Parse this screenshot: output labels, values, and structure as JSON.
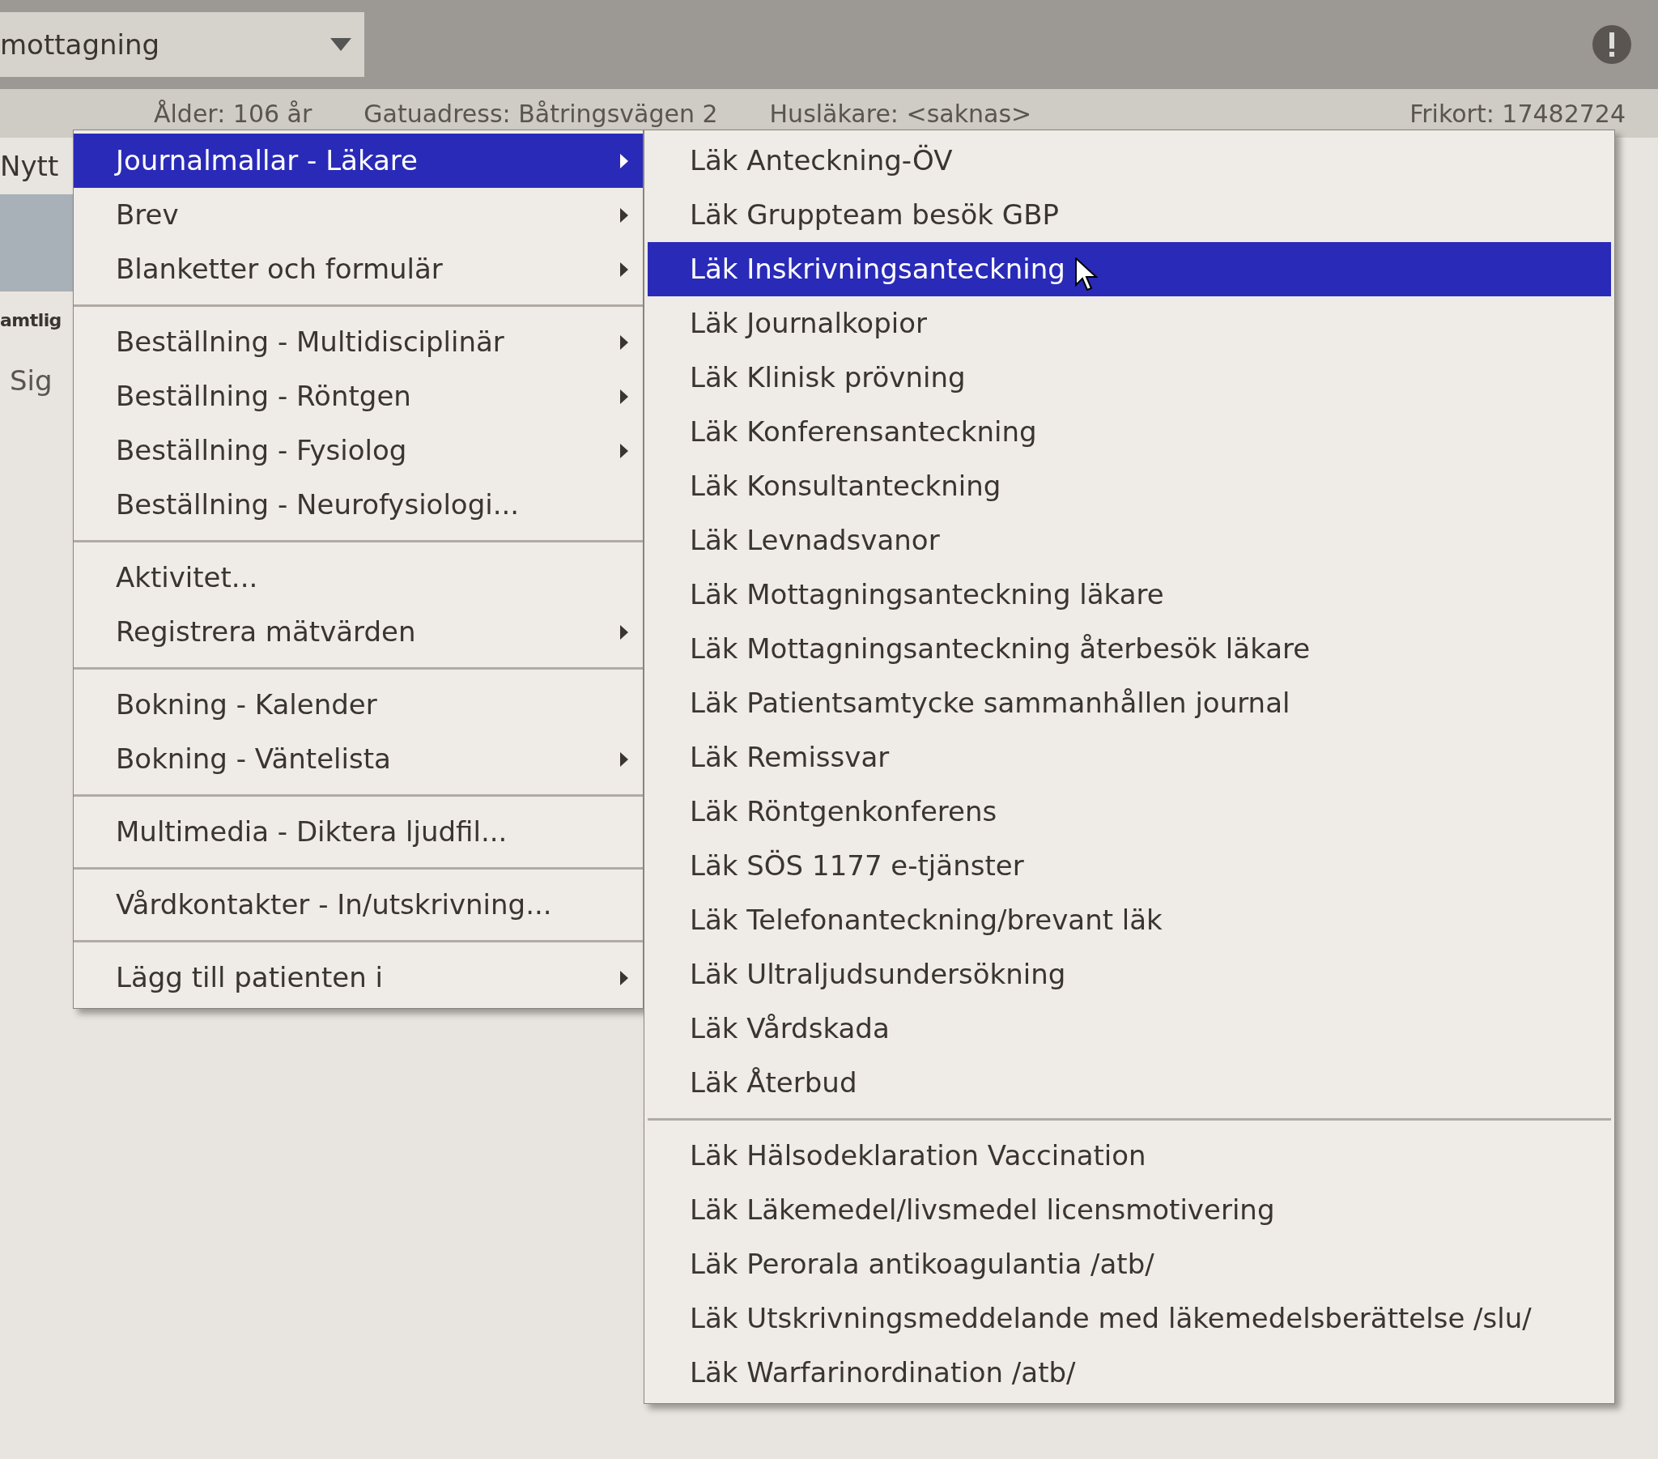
{
  "toolbar": {
    "unit_field": {
      "value": "mottagning"
    }
  },
  "patient_bar": {
    "items": [
      "Ålder: 106 år",
      "Gatuadress: Båtringsvägen 2",
      "Husläkare: <saknas>",
      "Frikort: 17482724"
    ]
  },
  "side": {
    "new_label": "Nytt",
    "tab_label": "amtlig",
    "sign_label": "Sig"
  },
  "menu": {
    "groups": [
      [
        {
          "label": "Journalmallar  -  Läkare",
          "submenu": true,
          "selected": true
        },
        {
          "label": "Brev",
          "submenu": true,
          "selected": false
        },
        {
          "label": "Blanketter och formulär",
          "submenu": true,
          "selected": false
        }
      ],
      [
        {
          "label": "Beställning  -  Multidisciplinär",
          "submenu": true,
          "selected": false
        },
        {
          "label": "Beställning  -  Röntgen",
          "submenu": true,
          "selected": false
        },
        {
          "label": "Beställning  -  Fysiolog",
          "submenu": true,
          "selected": false
        },
        {
          "label": "Beställning  -  Neurofysiologi...",
          "submenu": false,
          "selected": false
        }
      ],
      [
        {
          "label": "Aktivitet...",
          "submenu": false,
          "selected": false
        },
        {
          "label": "Registrera mätvärden",
          "submenu": true,
          "selected": false
        }
      ],
      [
        {
          "label": "Bokning  -  Kalender",
          "submenu": false,
          "selected": false
        },
        {
          "label": "Bokning  -  Väntelista",
          "submenu": true,
          "selected": false
        }
      ],
      [
        {
          "label": "Multimedia  -  Diktera ljudfil...",
          "submenu": false,
          "selected": false
        }
      ],
      [
        {
          "label": "Vårdkontakter  -  In/utskrivning...",
          "submenu": false,
          "selected": false
        }
      ],
      [
        {
          "label": "Lägg till patienten i",
          "submenu": true,
          "selected": false
        }
      ]
    ]
  },
  "submenu": {
    "groups": [
      [
        {
          "label": "Läk Anteckning-ÖV",
          "selected": false
        },
        {
          "label": "Läk Gruppteam besök GBP",
          "selected": false
        },
        {
          "label": "Läk Inskrivningsanteckning",
          "selected": true
        },
        {
          "label": "Läk Journalkopior",
          "selected": false
        },
        {
          "label": "Läk Klinisk prövning",
          "selected": false
        },
        {
          "label": "Läk Konferensanteckning",
          "selected": false
        },
        {
          "label": "Läk Konsultanteckning",
          "selected": false
        },
        {
          "label": "Läk Levnadsvanor",
          "selected": false
        },
        {
          "label": "Läk Mottagningsanteckning läkare",
          "selected": false
        },
        {
          "label": "Läk Mottagningsanteckning återbesök läkare",
          "selected": false
        },
        {
          "label": "Läk Patientsamtycke sammanhållen journal",
          "selected": false
        },
        {
          "label": "Läk Remissvar",
          "selected": false
        },
        {
          "label": "Läk Röntgenkonferens",
          "selected": false
        },
        {
          "label": "Läk SÖS 1177 e-tjänster",
          "selected": false
        },
        {
          "label": "Läk Telefonanteckning/brevant läk",
          "selected": false
        },
        {
          "label": "Läk Ultraljudsundersökning",
          "selected": false
        },
        {
          "label": "Läk Vårdskada",
          "selected": false
        },
        {
          "label": "Läk Återbud",
          "selected": false
        }
      ],
      [
        {
          "label": "Läk Hälsodeklaration Vaccination",
          "selected": false
        },
        {
          "label": "Läk Läkemedel/livsmedel licensmotivering",
          "selected": false
        },
        {
          "label": "Läk Perorala antikoagulantia /atb/",
          "selected": false
        },
        {
          "label": "Läk Utskrivningsmeddelande med läkemedelsberättelse /slu/",
          "selected": false
        },
        {
          "label": "Läk Warfarinordination /atb/",
          "selected": false
        }
      ]
    ]
  }
}
